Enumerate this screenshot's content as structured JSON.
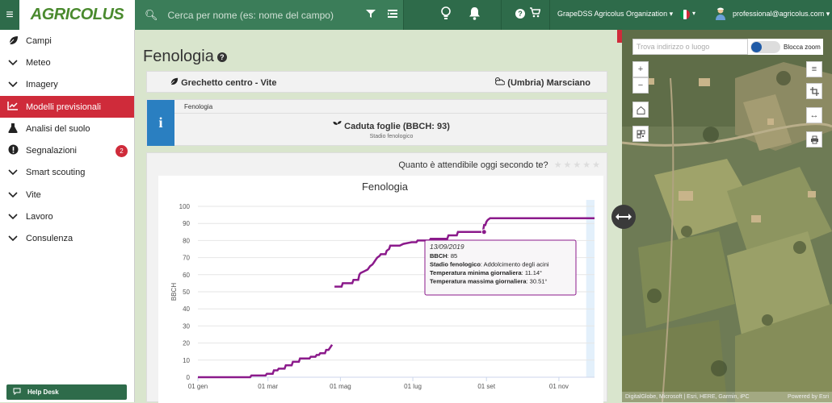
{
  "topbar": {
    "logo_text": "AGRICOLUS",
    "search_placeholder": "Cerca per nome (es: nome del campo)",
    "organization": "GrapeDSS Agricolus Organization",
    "user_email": "professional@agricolus.com",
    "flag_colors": [
      "#009246",
      "#ffffff",
      "#ce2b37"
    ],
    "icons": [
      "menu-icon",
      "search-icon",
      "filter-icon",
      "list-icon",
      "lightbulb-icon",
      "bell-icon",
      "help-icon",
      "cart-icon",
      "user-icon"
    ]
  },
  "sidebar": {
    "items": [
      {
        "label": "Campi",
        "icon": "leaf-icon",
        "active": false
      },
      {
        "label": "Meteo",
        "icon": "chevron-down-icon",
        "active": false
      },
      {
        "label": "Imagery",
        "icon": "chevron-down-icon",
        "active": false
      },
      {
        "label": "Modelli previsionali",
        "icon": "chart-line-icon",
        "active": true
      },
      {
        "label": "Analisi del suolo",
        "icon": "flask-icon",
        "active": false
      },
      {
        "label": "Segnalazioni",
        "icon": "alert-icon",
        "active": false,
        "badge": "2"
      },
      {
        "label": "Smart scouting",
        "icon": "chevron-down-icon",
        "active": false
      },
      {
        "label": "Vite",
        "icon": "chevron-down-icon",
        "active": false
      },
      {
        "label": "Lavoro",
        "icon": "chevron-down-icon",
        "active": false
      },
      {
        "label": "Consulenza",
        "icon": "chevron-down-icon",
        "active": false
      }
    ],
    "helpdesk_label": "Help Desk",
    "accent": "#cf2b3a",
    "brand": "#2e6b4a"
  },
  "main": {
    "title": "Fenologia",
    "field_name": "Grechetto centro - Vite",
    "location": "(Umbria) Marsciano",
    "pheno_card": {
      "label": "Fenologia",
      "value": "Caduta foglie (BBCH: 93)",
      "sub": "Stadio fenologico"
    },
    "rating_question": "Quanto è attendibile oggi secondo te?",
    "rating_stars": "★★★★★"
  },
  "chart_data": {
    "type": "line",
    "title": "Fenologia",
    "ylabel": "BBCH",
    "xlabel": "",
    "ylim": [
      0,
      100
    ],
    "yticks": [
      0,
      10,
      20,
      30,
      40,
      50,
      60,
      70,
      80,
      90,
      100
    ],
    "xticks": [
      "01 gen",
      "01 mar",
      "01 mag",
      "01 lug",
      "01 set",
      "01 nov"
    ],
    "xtick_days": [
      0,
      59,
      120,
      181,
      243,
      304
    ],
    "x_max_day": 334,
    "color": "#8b1a8b",
    "series": [
      {
        "points": [
          [
            0,
            0
          ],
          [
            44,
            0
          ],
          [
            45,
            1
          ],
          [
            57,
            1
          ],
          [
            58,
            2
          ],
          [
            63,
            2
          ],
          [
            64,
            4
          ],
          [
            67,
            4
          ],
          [
            68,
            5
          ],
          [
            73,
            5
          ],
          [
            74,
            7
          ],
          [
            79,
            7
          ],
          [
            80,
            9
          ],
          [
            85,
            9
          ],
          [
            86,
            11
          ],
          [
            94,
            11
          ],
          [
            95,
            12
          ],
          [
            99,
            12
          ],
          [
            100,
            13
          ],
          [
            102,
            13
          ],
          [
            103,
            14
          ],
          [
            107,
            14
          ],
          [
            108,
            16
          ],
          [
            110,
            16
          ],
          [
            111,
            17
          ],
          [
            113,
            19
          ]
        ]
      },
      {
        "points": [
          [
            115,
            53
          ],
          [
            121,
            53
          ],
          [
            122,
            55
          ],
          [
            130,
            55
          ],
          [
            131,
            57
          ],
          [
            135,
            57
          ],
          [
            136,
            60
          ],
          [
            137,
            61
          ],
          [
            140,
            62
          ],
          [
            143,
            63
          ],
          [
            145,
            65
          ],
          [
            147,
            66
          ],
          [
            148,
            67
          ],
          [
            150,
            69
          ],
          [
            151,
            70
          ],
          [
            153,
            71
          ],
          [
            154,
            72
          ],
          [
            158,
            72
          ],
          [
            159,
            74
          ],
          [
            161,
            75
          ],
          [
            162,
            77
          ],
          [
            166,
            77
          ],
          [
            168,
            77
          ],
          [
            170,
            77
          ],
          [
            173,
            78
          ],
          [
            180,
            79
          ],
          [
            184,
            79
          ],
          [
            185,
            80
          ],
          [
            195,
            80
          ],
          [
            196,
            81
          ],
          [
            210,
            81
          ],
          [
            211,
            83
          ],
          [
            218,
            83
          ],
          [
            219,
            85
          ],
          [
            240,
            85
          ],
          [
            241,
            89
          ],
          [
            242,
            89
          ],
          [
            243,
            91
          ],
          [
            244,
            92
          ],
          [
            246,
            93
          ],
          [
            334,
            93
          ]
        ]
      }
    ],
    "highlight_band": {
      "from_day": 327,
      "to_day": 334
    },
    "tooltip": {
      "date": "13/09/2019",
      "day": 241,
      "value": 85,
      "lines": [
        {
          "label": "BBCH",
          "value": "85"
        },
        {
          "label": "Stadio fenologico",
          "value": "Addolcimento degli acini"
        },
        {
          "label": "Temperatura minima giornaliera",
          "value": "11.14°"
        },
        {
          "label": "Temperatura massima giornaliera",
          "value": "30.51°"
        }
      ]
    }
  },
  "map": {
    "search_placeholder": "Trova indirizzo o luogo",
    "lock_zoom_label": "Blocca zoom",
    "attribution_left": "DigitalGlobe, Microsoft | Esri, HERE, Garmin, iPC",
    "attribution_right": "Powered by Esri"
  }
}
